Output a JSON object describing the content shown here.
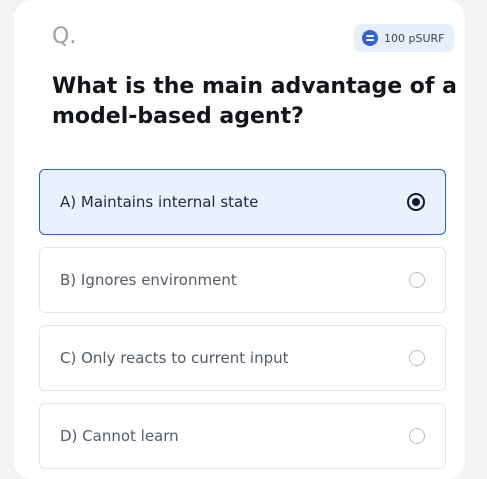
{
  "header": {
    "q_label": "Q.",
    "reward": "100 pSURF"
  },
  "question": {
    "text": "What is the main advantage of a model-based agent?"
  },
  "options": [
    {
      "label": "A) Maintains internal state",
      "selected": true
    },
    {
      "label": "B) Ignores environment",
      "selected": false
    },
    {
      "label": "C) Only reacts to current input",
      "selected": false
    },
    {
      "label": "D) Cannot learn",
      "selected": false
    }
  ],
  "colors": {
    "accent": "#2d5fc4",
    "selected_bg": "#eaf1fd",
    "reward_bg": "#e7eefc",
    "coin": "#2f62d9"
  },
  "icons": {
    "reward": "coin-icon",
    "choice": "radio-icon"
  }
}
